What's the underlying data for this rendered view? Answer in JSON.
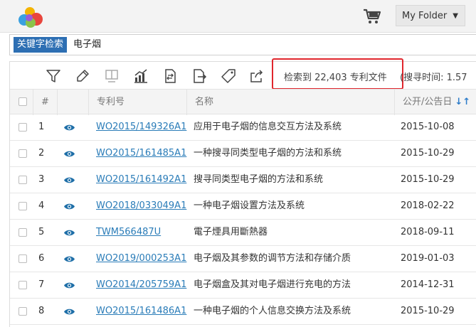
{
  "header": {
    "logo_icon": "colorful-cloud-logo",
    "cart_icon": "shopping-cart-icon",
    "folder_label": "My Folder"
  },
  "search": {
    "tag_label": "关键字检索",
    "query": "电子烟"
  },
  "toolbar": {
    "icons": [
      "filter-icon",
      "highlight-pen-icon",
      "reader-view-icon",
      "analytics-chart-icon",
      "compare-icon",
      "export-icon",
      "tag-icon",
      "share-icon"
    ],
    "result_text": "检索到 22,403 专利文件",
    "time_text": "(搜寻时间: 1.57"
  },
  "table": {
    "columns": {
      "index": "#",
      "patent_no": "专利号",
      "title": "名称",
      "date": "公开/公告日"
    },
    "rows": [
      {
        "index": "1",
        "patent_no": "WO2015/149326A1",
        "title": "应用于电子烟的信息交互方法及系统",
        "date": "2015-10-08"
      },
      {
        "index": "2",
        "patent_no": "WO2015/161485A1",
        "title": "一种搜寻同类型电子烟的方法和系统",
        "date": "2015-10-29"
      },
      {
        "index": "3",
        "patent_no": "WO2015/161492A1",
        "title": "搜寻同类型电子烟的方法和系统",
        "date": "2015-10-29"
      },
      {
        "index": "4",
        "patent_no": "WO2018/033049A1",
        "title": "一种电子烟设置方法及系统",
        "date": "2018-02-22"
      },
      {
        "index": "5",
        "patent_no": "TWM566487U",
        "title": "電子煙具用斷熱器",
        "date": "2018-09-11"
      },
      {
        "index": "6",
        "patent_no": "WO2019/000253A1",
        "title": "电子烟及其参数的调节方法和存储介质",
        "date": "2019-01-03"
      },
      {
        "index": "7",
        "patent_no": "WO2014/205759A1",
        "title": "电子烟盒及其对电子烟进行充电的方法",
        "date": "2014-12-31"
      },
      {
        "index": "8",
        "patent_no": "WO2015/161486A1",
        "title": "一种电子烟的个人信息交换方法及系统",
        "date": "2015-10-29"
      }
    ]
  },
  "colors": {
    "accent": "#2d6fb3",
    "link": "#2a7cb8",
    "highlight_border": "#e0262d"
  }
}
